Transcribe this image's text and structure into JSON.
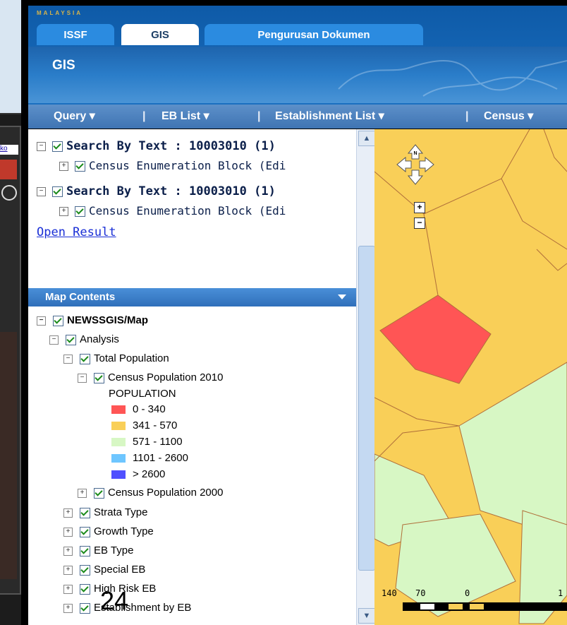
{
  "brand": {
    "country_label": "MALAYSIA"
  },
  "tabs": [
    {
      "label": "ISSF"
    },
    {
      "label": "GIS"
    },
    {
      "label": "Pengurusan Dokumen"
    }
  ],
  "page_title": "GIS",
  "menu": {
    "items": [
      {
        "label": "Query  ▾"
      },
      {
        "label": "EB List  ▾"
      },
      {
        "label": "Establishment List  ▾"
      },
      {
        "label": "Census  ▾"
      }
    ],
    "separator": "|"
  },
  "results": [
    {
      "title": "Search By Text : 10003010 (1)",
      "child": "Census Enumeration Block (Edi"
    },
    {
      "title": "Search By Text : 10003010 (1)",
      "child": "Census Enumeration Block (Edi"
    }
  ],
  "open_result_label": "Open Result",
  "map_contents": {
    "header": "Map Contents",
    "root": "NEWSSGIS/Map",
    "analysis": "Analysis",
    "total_population": "Total Population",
    "census_2010": "Census Population 2010",
    "legend_title": "POPULATION",
    "legend": [
      {
        "label": "0 - 340",
        "color": "#ff5555"
      },
      {
        "label": "341 - 570",
        "color": "#f9cf58"
      },
      {
        "label": "571 - 1100",
        "color": "#d7f7c4"
      },
      {
        "label": "1101 - 2600",
        "color": "#6ec6ff"
      },
      {
        "label": "> 2600",
        "color": "#5050ff"
      }
    ],
    "census_2000": "Census Population 2000",
    "layers": [
      {
        "label": "Strata Type"
      },
      {
        "label": "Growth Type"
      },
      {
        "label": "EB Type"
      },
      {
        "label": "Special EB"
      },
      {
        "label": "High Risk EB"
      },
      {
        "label": "Establishment by EB"
      }
    ]
  },
  "map": {
    "scale_labels": [
      "140",
      "70",
      "0",
      "1"
    ],
    "zoom_in": "+",
    "zoom_out": "−",
    "north_label": "N"
  },
  "background_window": {
    "link_text": "ko"
  },
  "page_number": "24"
}
